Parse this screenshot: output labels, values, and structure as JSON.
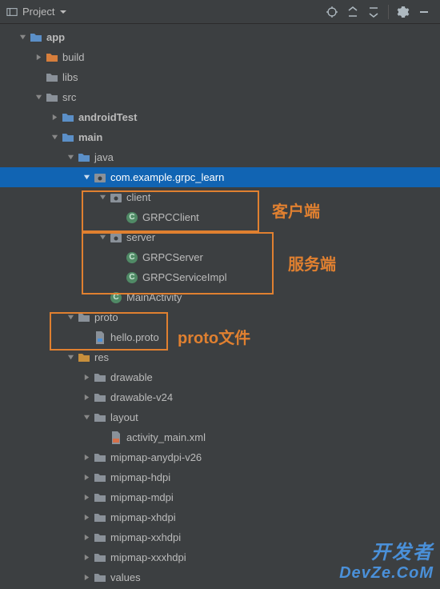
{
  "toolbar": {
    "view_label": "Project"
  },
  "tree": {
    "app": "app",
    "build": "build",
    "libs": "libs",
    "src": "src",
    "androidTest": "androidTest",
    "main": "main",
    "java": "java",
    "pkg": "com.example.grpc_learn",
    "client": "client",
    "grpcclient": "GRPCClient",
    "server": "server",
    "grpcserver": "GRPCServer",
    "grpcserviceimpl": "GRPCServiceImpl",
    "mainactivity": "MainActivity",
    "proto": "proto",
    "helloproto": "hello.proto",
    "res": "res",
    "drawable": "drawable",
    "drawablev24": "drawable-v24",
    "layout": "layout",
    "activitymain": "activity_main.xml",
    "mipmap_anydpi": "mipmap-anydpi-v26",
    "mipmap_hdpi": "mipmap-hdpi",
    "mipmap_mdpi": "mipmap-mdpi",
    "mipmap_xhdpi": "mipmap-xhdpi",
    "mipmap_xxhdpi": "mipmap-xxhdpi",
    "mipmap_xxxhdpi": "mipmap-xxxhdpi",
    "values": "values"
  },
  "annotations": {
    "client_label": "客户端",
    "server_label": "服务端",
    "proto_label": "proto文件"
  },
  "watermark": {
    "line1": "开发者",
    "line2": "DevZe.CoM"
  },
  "colors": {
    "selection": "#1164b3",
    "highlight": "#e08030",
    "watermark": "#4a90d9"
  }
}
